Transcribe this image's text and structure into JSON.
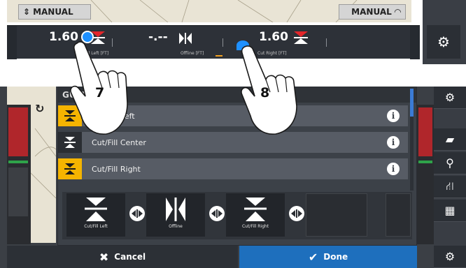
{
  "top_bar": {
    "manual_left_label": "MANUAL",
    "manual_right_label": "MANUAL",
    "readouts": [
      {
        "value": "1.60",
        "label": "Cut/Fill Left [FT]"
      },
      {
        "value": "-.--",
        "label": "Offline [FT]"
      },
      {
        "value": "1.60",
        "label": "Cut Right [FT]"
      }
    ]
  },
  "steps": {
    "step7": "7",
    "step8": "8"
  },
  "modal": {
    "title": "GUIDANCE",
    "rows": [
      {
        "label": "Cut/Fill Left",
        "highlighted": true
      },
      {
        "label": "Cut/Fill Center",
        "highlighted": false
      },
      {
        "label": "Cut/Fill Right",
        "highlighted": true
      }
    ],
    "tiles": [
      {
        "label": "Cut/Fill Left",
        "icon": "cut-fill-icon"
      },
      {
        "label": "Offline",
        "icon": "offline-icon"
      },
      {
        "label": "Cut/Fill Right",
        "icon": "cut-fill-icon"
      }
    ]
  },
  "buttons": {
    "cancel": "Cancel",
    "done": "Done"
  },
  "colors": {
    "accent_yellow": "#f5b400",
    "done_blue": "#1e6fbd",
    "arrow_red": "#e3262b",
    "marker_blue": "#1e90ff"
  }
}
